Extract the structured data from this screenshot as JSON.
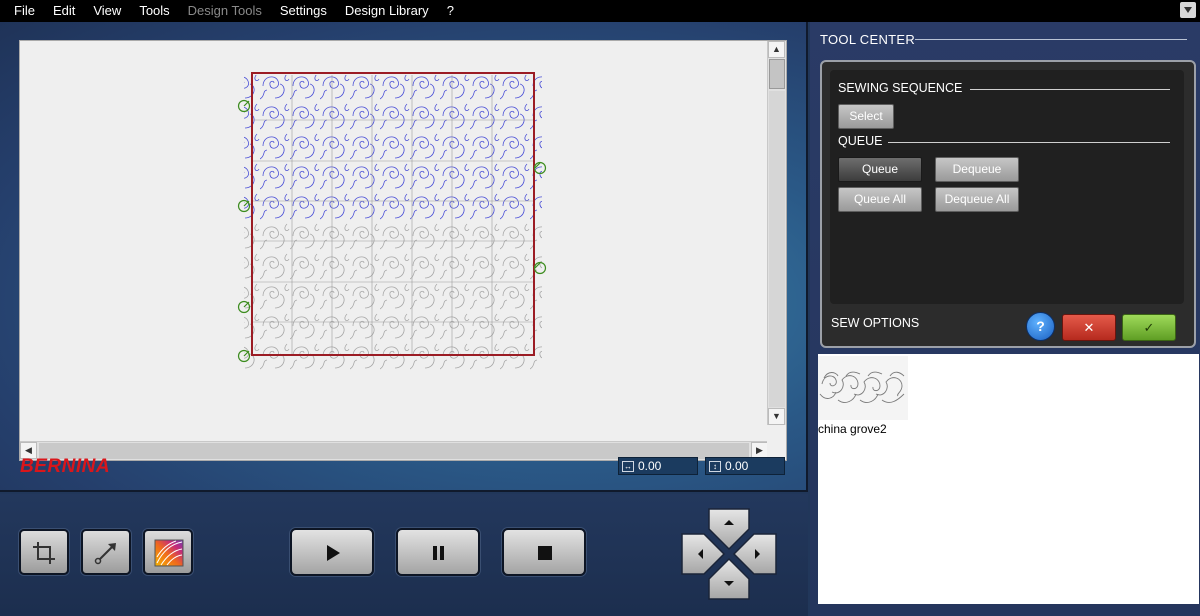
{
  "menu": {
    "items": [
      {
        "label": "File",
        "enabled": true
      },
      {
        "label": "Edit",
        "enabled": true
      },
      {
        "label": "View",
        "enabled": true
      },
      {
        "label": "Tools",
        "enabled": true
      },
      {
        "label": "Design Tools",
        "enabled": false
      },
      {
        "label": "Settings",
        "enabled": true
      },
      {
        "label": "Design Library",
        "enabled": true
      },
      {
        "label": "?",
        "enabled": true
      }
    ]
  },
  "brand": {
    "name": "BERNINA",
    "color": "#d9161b"
  },
  "coords": {
    "x": "0.00",
    "y": "0.00"
  },
  "design": {
    "boundary_color": "#9b1c24",
    "sewn_color": "#4a4fd6",
    "unsewn_color": "#a8a8a8",
    "marker_color": "#3c8c1e"
  },
  "toolbar": {
    "tools": [
      "crop-icon",
      "path-icon",
      "color-palette-icon"
    ],
    "transport": [
      "play-icon",
      "pause-icon",
      "stop-icon"
    ],
    "dpad": [
      "arrow-up-icon",
      "arrow-down-icon",
      "arrow-left-icon",
      "arrow-right-icon"
    ]
  },
  "tool_center": {
    "title": "TOOL CENTER",
    "sewing_sequence": {
      "label": "SEWING SEQUENCE",
      "select_label": "Select"
    },
    "queue": {
      "label": "QUEUE",
      "queue_label": "Queue",
      "dequeue_label": "Dequeue",
      "queue_all_label": "Queue All",
      "dequeue_all_label": "Dequeue All",
      "active": "Queue"
    },
    "sew_options": {
      "label": "SEW OPTIONS",
      "help": "?",
      "cancel": "✕",
      "confirm": "✓"
    }
  },
  "library": {
    "items": [
      {
        "name": "china grove2"
      }
    ]
  }
}
